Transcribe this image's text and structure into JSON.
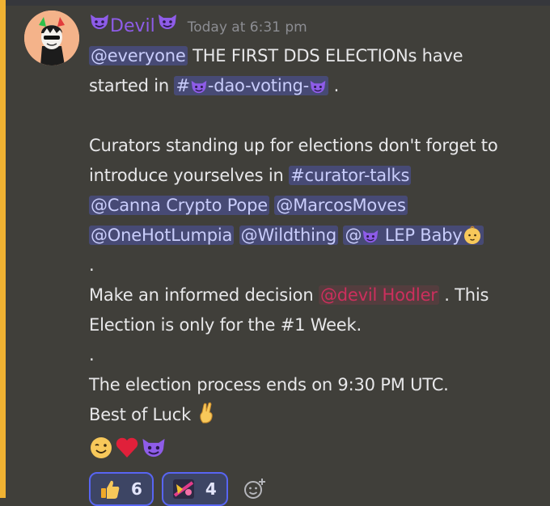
{
  "author": "Devil",
  "timestamp": "Today at 6:31 pm",
  "message": {
    "line1": {
      "mention": "@everyone",
      "text": "THE FIRST DDS ELECTIONs have"
    },
    "line2": {
      "prefix": "started in",
      "channel_hash": "#",
      "channel_name": "-dao-voting-",
      "suffix": "."
    },
    "line3": "Curators standing up for elections don't forget to",
    "line4": {
      "prefix": "introduce yourselves in",
      "channel": "#curator-talks"
    },
    "line5": {
      "mention_a": "@Canna Crypto Pope",
      "mention_b": "@MarcosMoves"
    },
    "line6": {
      "mention_a": "@OneHotLumpia",
      "mention_b": "@Wildthing",
      "mention_c_at": "@",
      "mention_c_name": "LEP Baby"
    },
    "dot1": ".",
    "line7": {
      "prefix": "Make an informed decision",
      "role": "@devil Hodler",
      "suffix": ". This"
    },
    "line8": "Election is only for the #1 Week.",
    "dot2": ".",
    "line9": "The election process ends on 9:30 PM UTC.",
    "line10": "Best of Luck"
  },
  "icons": {
    "author_badge": "smiling-imp-icon",
    "crossed_fingers": "crossed-fingers-icon",
    "wink": "winking-face-icon",
    "heart": "red-heart-icon",
    "imp": "smiling-imp-icon",
    "baby": "baby-icon",
    "thumbs_up": "thumbs-up-icon",
    "custom_reaction": "custom-emoji-icon",
    "add_reaction": "add-reaction-icon"
  },
  "reactions": [
    {
      "icon": "thumbs-up-icon",
      "count": "6"
    },
    {
      "icon": "custom-emoji-icon",
      "count": "4"
    }
  ],
  "colors": {
    "author": "#8e5ce8",
    "mention_bg": "#5865f2",
    "role_mention": "#cc2f5d",
    "left_bar": "#f0b232"
  }
}
